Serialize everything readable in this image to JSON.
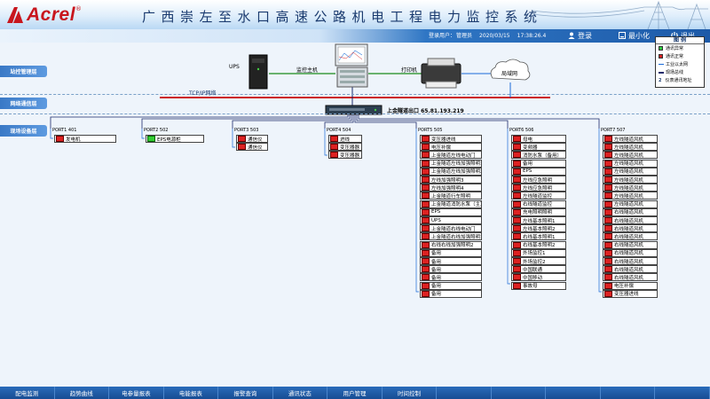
{
  "header": {
    "logo_text": "Acrel",
    "logo_reg": "®",
    "title": "广西崇左至水口高速公路机电工程电力监控系统",
    "user_label": "登录用户：",
    "user_name": "管理员",
    "date": "2020/03/15",
    "time": "17:38:26.4",
    "buttons": [
      {
        "label": "登录",
        "icon": "user-icon"
      },
      {
        "label": "最小化",
        "icon": "minimize-icon"
      },
      {
        "label": "退出",
        "icon": "exit-icon"
      }
    ]
  },
  "levels": {
    "station": "站控管理层",
    "network": "网络通信层",
    "field": "现场设备层"
  },
  "devices": {
    "ups": "UPS",
    "host": "监控主机",
    "printer": "打印机",
    "lan": "局域网",
    "tcpip": "TCP/IP网络",
    "gateway": "上金隧道出口",
    "gateway_ip": "65.81.193.219"
  },
  "legend": {
    "title": "图  例",
    "items": [
      {
        "label": "通讯异常",
        "color": "#2ecc40"
      },
      {
        "label": "通讯正常",
        "color": "#d42020"
      },
      {
        "label": "工业以太网",
        "color": "#1a6ad8"
      },
      {
        "label": "现场总线",
        "color": "#1c2a6b"
      },
      {
        "label": "仪表通讯地址",
        "symbol": "2"
      }
    ]
  },
  "ports": [
    {
      "name": "PORT1 401",
      "items": [
        {
          "label": "发电机"
        }
      ]
    },
    {
      "name": "PORT2 502",
      "items": [
        {
          "label": "EPS电源柜",
          "ok": true
        }
      ]
    },
    {
      "name": "PORT3 503",
      "items": [
        {
          "label": "通信仪"
        },
        {
          "label": "通信仪"
        }
      ]
    },
    {
      "name": "PORT4 504",
      "items": [
        {
          "label": "进线"
        },
        {
          "label": "变压器器"
        },
        {
          "label": "变压器器"
        }
      ]
    },
    {
      "name": "PORT5 505",
      "items": [
        {
          "label": "变压器进线"
        },
        {
          "label": "电压补偿"
        },
        {
          "label": "上金隧道左线电动门"
        },
        {
          "label": "上金隧道左线加强照明1"
        },
        {
          "label": "上金隧道左线加强照明2"
        },
        {
          "label": "左线加强照明3"
        },
        {
          "label": "左线加强照明4"
        },
        {
          "label": "上金隧道行车照明"
        },
        {
          "label": "上金隧道消防水泵（主）"
        },
        {
          "label": "EPS"
        },
        {
          "label": "UPS"
        },
        {
          "label": "上金隧道右线电动门"
        },
        {
          "label": "上金隧道右线加强照明1"
        },
        {
          "label": "右线右线加强照明2"
        },
        {
          "label": "备用"
        },
        {
          "label": "备用"
        },
        {
          "label": "备用"
        },
        {
          "label": "备用"
        },
        {
          "label": "备用"
        },
        {
          "label": "备用"
        }
      ]
    },
    {
      "name": "PORT6 506",
      "items": [
        {
          "label": "母电"
        },
        {
          "label": "变频器"
        },
        {
          "label": "消防水泵（备用）"
        },
        {
          "label": "备用"
        },
        {
          "label": "EPS"
        },
        {
          "label": "左线应急照明"
        },
        {
          "label": "左线应急照明"
        },
        {
          "label": "左线隧道监控"
        },
        {
          "label": "右线隧道监控"
        },
        {
          "label": "充电照明照明"
        },
        {
          "label": "左线基本照明1"
        },
        {
          "label": "左线基本照明2"
        },
        {
          "label": "右线基本照明1"
        },
        {
          "label": "右线基本照明2"
        },
        {
          "label": "外场监控1"
        },
        {
          "label": "外场监控2"
        },
        {
          "label": "中国联通"
        },
        {
          "label": "中国移动"
        },
        {
          "label": "事故母"
        }
      ]
    },
    {
      "name": "PORT7 507",
      "items": [
        {
          "label": "左线隧道风机"
        },
        {
          "label": "左线隧道风机"
        },
        {
          "label": "左线隧道风机"
        },
        {
          "label": "左线隧道风机"
        },
        {
          "label": "左线隧道风机"
        },
        {
          "label": "左线隧道风机"
        },
        {
          "label": "左线隧道风机"
        },
        {
          "label": "左线隧道风机"
        },
        {
          "label": "左线隧道风机"
        },
        {
          "label": "右线隧道风机"
        },
        {
          "label": "右线隧道风机"
        },
        {
          "label": "右线隧道风机"
        },
        {
          "label": "右线隧道风机"
        },
        {
          "label": "右线隧道风机"
        },
        {
          "label": "右线隧道风机"
        },
        {
          "label": "右线隧道风机"
        },
        {
          "label": "右线隧道风机"
        },
        {
          "label": "右线隧道风机"
        },
        {
          "label": "电压补偿"
        },
        {
          "label": "变压器进线"
        }
      ]
    }
  ],
  "footer": {
    "tabs": [
      "配电监测",
      "趋势曲线",
      "电参量报表",
      "电能报表",
      "报警查询",
      "通讯状态",
      "用户管理",
      "时间控制",
      "",
      "",
      "",
      "",
      ""
    ]
  }
}
